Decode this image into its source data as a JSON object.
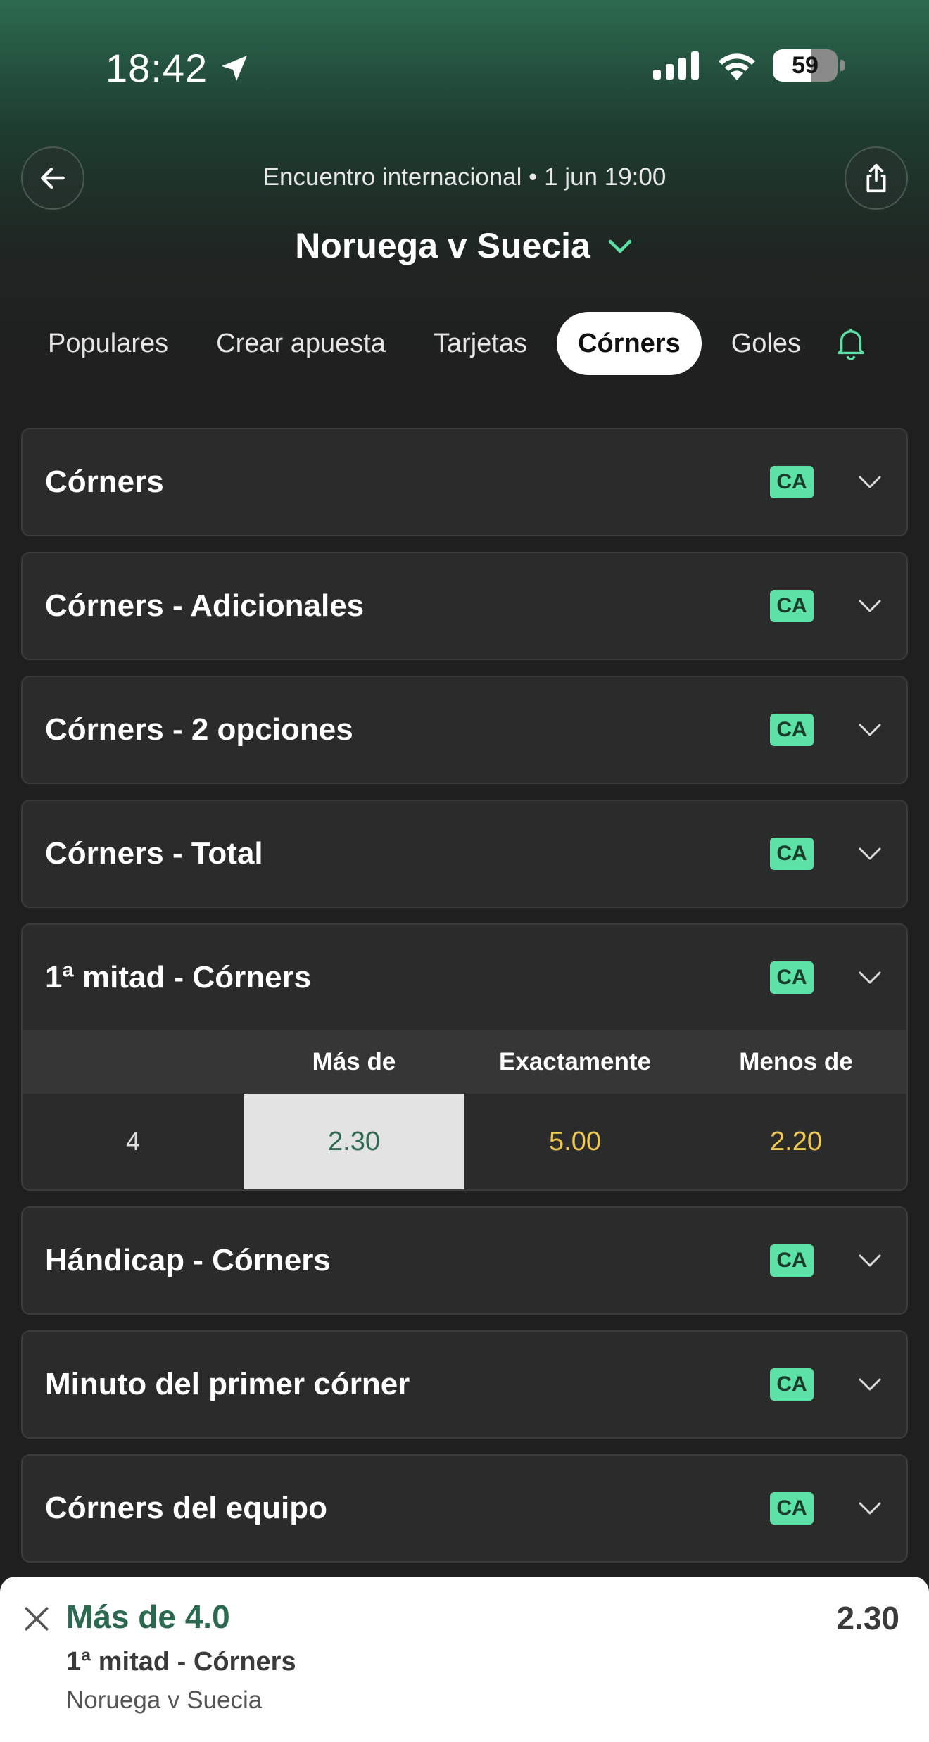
{
  "status": {
    "time": "18:42",
    "battery": "59"
  },
  "header": {
    "subtitle": "Encuentro internacional • 1 jun 19:00",
    "title": "Noruega v Suecia"
  },
  "tabs": [
    {
      "label": "Populares"
    },
    {
      "label": "Crear apuesta"
    },
    {
      "label": "Tarjetas"
    },
    {
      "label": "Córners"
    },
    {
      "label": "Goles"
    }
  ],
  "markets": [
    {
      "title": "Córners",
      "badge": "CA"
    },
    {
      "title": "Córners - Adicionales",
      "badge": "CA"
    },
    {
      "title": "Córners - 2 opciones",
      "badge": "CA"
    },
    {
      "title": "Córners - Total",
      "badge": "CA"
    },
    {
      "title": "1ª mitad - Córners",
      "badge": "CA"
    },
    {
      "title": "Hándicap - Córners",
      "badge": "CA"
    },
    {
      "title": "Minuto del primer córner",
      "badge": "CA"
    },
    {
      "title": "Córners del equipo",
      "badge": "CA"
    }
  ],
  "expanded": {
    "columns": [
      "Más de",
      "Exactamente",
      "Menos de"
    ],
    "row": {
      "line": "4",
      "over": "2.30",
      "exact": "5.00",
      "under": "2.20"
    }
  },
  "betslip": {
    "selection": "Más de 4.0",
    "market": "1ª mitad - Córners",
    "event": "Noruega v Suecia",
    "odds": "2.30"
  },
  "colors": {
    "accent": "#5ce1a6",
    "brand_green": "#2c6a4f",
    "odds_yellow": "#f2c94c"
  }
}
